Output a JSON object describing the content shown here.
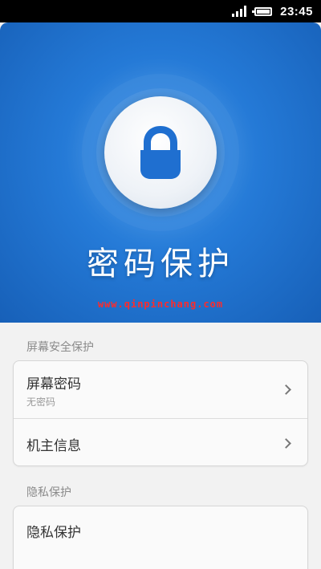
{
  "status_bar": {
    "time": "23:45",
    "icons": [
      "signal-icon",
      "battery-icon"
    ]
  },
  "hero": {
    "title": "密码保护",
    "watermark": "www.qinpinchang.com",
    "icon": "lock-icon",
    "colors": {
      "gradient_center": "#3d93e8",
      "gradient_edge": "#1760b8"
    }
  },
  "screen_security": {
    "header": "屏幕安全保护",
    "items": [
      {
        "title": "屏幕密码",
        "subtitle": "无密码"
      },
      {
        "title": "机主信息"
      }
    ]
  },
  "privacy": {
    "header": "隐私保护",
    "items": [
      {
        "title": "隐私保护"
      }
    ]
  }
}
